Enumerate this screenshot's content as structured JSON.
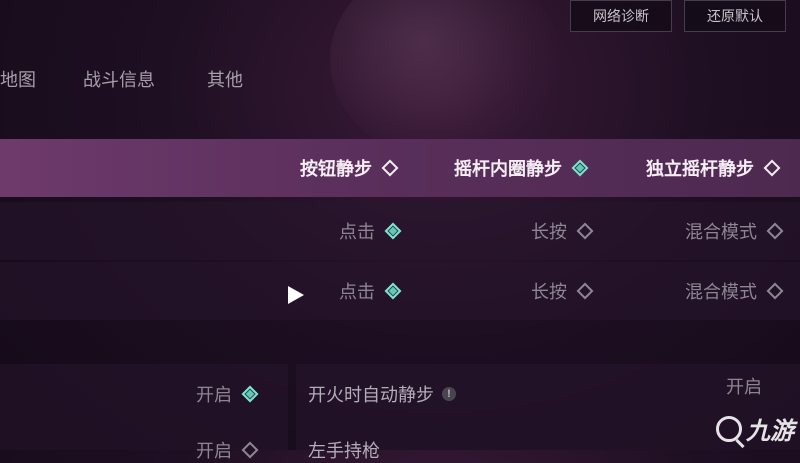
{
  "top_buttons": {
    "network": "网络诊断",
    "reset": "还原默认"
  },
  "tabs": [
    "地图",
    "战斗信息",
    "其他"
  ],
  "header_row": {
    "options": [
      {
        "label": "按钮静步",
        "checked": false
      },
      {
        "label": "摇杆内圈静步",
        "checked": true
      },
      {
        "label": "独立摇杆静步",
        "checked": false
      }
    ]
  },
  "row1": {
    "options": [
      {
        "label": "点击",
        "checked": true
      },
      {
        "label": "长按",
        "checked": false
      },
      {
        "label": "混合模式",
        "checked": false
      }
    ]
  },
  "row2": {
    "options": [
      {
        "label": "点击",
        "checked": true
      },
      {
        "label": "长按",
        "checked": false
      },
      {
        "label": "混合模式",
        "checked": false
      }
    ]
  },
  "bottom": {
    "left_opt1": "开启",
    "left_opt2": "开启",
    "fire_auto_walk": "开火时自动静步",
    "left_hand_fire": "左手持枪",
    "right_partial": "开启",
    "info_mark": "!"
  },
  "watermark": "九游"
}
